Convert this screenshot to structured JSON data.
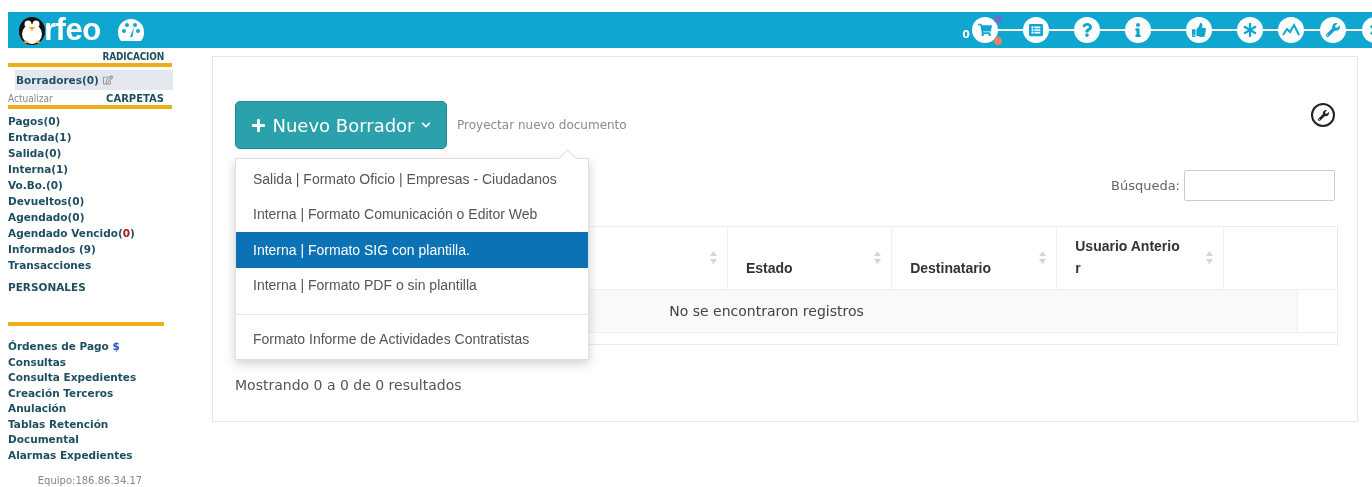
{
  "header": {
    "logo_text": "rfeo",
    "cart_count": "0"
  },
  "sidebar": {
    "radicacion_title": "RADICACION",
    "drafts": {
      "label": "Borradores(0)",
      "selected": true
    },
    "refresh": "Actualizar",
    "folders_title": "CARPETAS",
    "folders": [
      {
        "text": "Pagos(0)"
      },
      {
        "text": "Entrada(1)"
      },
      {
        "text": "Salida(0)"
      },
      {
        "text": "Interna(1)"
      },
      {
        "text": "Vo.Bo.(0)"
      },
      {
        "text": "Devueltos(0)"
      },
      {
        "text": "Agendado(0)"
      },
      {
        "text": "Agendado Vencido(",
        "alert": "0",
        "tail": ")"
      },
      {
        "text": "Informados (9)"
      },
      {
        "text": "Transacciones"
      }
    ],
    "personal_title": "PERSONALES",
    "tools": [
      {
        "text": "Órdenes de Pago",
        "suffix": "$"
      },
      {
        "text": "Consultas"
      },
      {
        "text": "Consulta Expedientes"
      },
      {
        "text": "Creación Terceros"
      },
      {
        "text": "Anulación"
      },
      {
        "text": "Tablas Retención Documental"
      },
      {
        "text": "Alarmas Expedientes"
      }
    ],
    "equipment": "Equipo:186.86.34.17"
  },
  "main": {
    "new_button": "Nuevo Borrador",
    "hint": "Proyectar nuevo documento",
    "menu": [
      {
        "label": "Salida | Formato Oficio | Empresas - Ciudadanos",
        "selected": false,
        "divider_before": false
      },
      {
        "label": "Interna | Formato Comunicación o Editor Web",
        "selected": false,
        "divider_before": false
      },
      {
        "label": "Interna | Formato SIG con plantilla.",
        "selected": true,
        "divider_before": false
      },
      {
        "label": "Interna | Formato PDF o sin plantilla",
        "selected": false,
        "divider_before": false
      },
      {
        "label": "Formato Informe de Actividades Contratistas",
        "selected": false,
        "divider_before": true
      }
    ],
    "search_label": "Búsqueda:",
    "table": {
      "columns": [
        "Estado",
        "Destinatario",
        "Usuario Anterior"
      ],
      "empty_message": "No se encontraron registros"
    },
    "footer": "Mostrando 0 a 0 de 0 resultados"
  }
}
